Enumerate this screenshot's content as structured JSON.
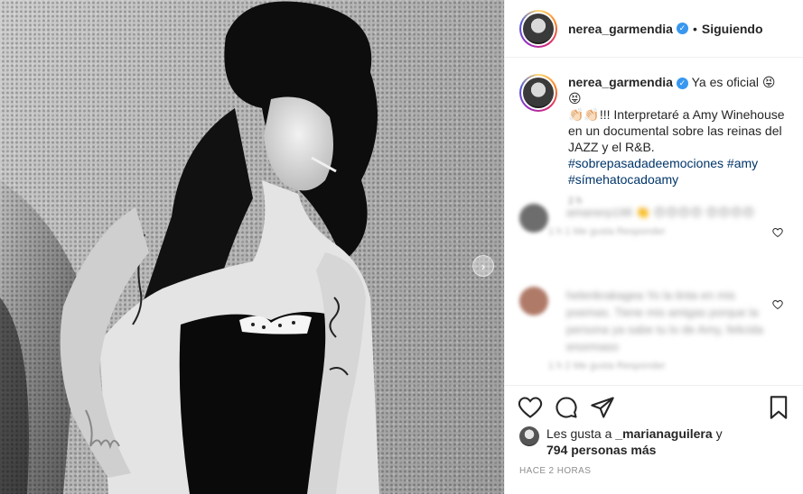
{
  "header": {
    "username": "nerea_garmendia",
    "separator": "•",
    "follow_label": "Siguiendo"
  },
  "caption": {
    "username": "nerea_garmendia",
    "line1": "Ya es oficial 😝😝",
    "line2": "👏🏻👏🏻!!! Interpretaré a Amy Winehouse",
    "line3": "en un documental sobre las reinas del",
    "line4": "JAZZ y el R&B.",
    "hashtags1": "#sobrepasadadeemociones #amy",
    "hashtags2": "#símehatocadoamy",
    "time": "2 h"
  },
  "comments": [
    {
      "text": "amanerp198 👏 😍😍😍😍 😍😍😍😍",
      "meta": "1 h   1 Me gusta   Responder"
    },
    {
      "text": "helenkrakagea Yo la tinta en mis poemas. Tiene mis amigas porque la persona ya sabe tu lo de Amy, felicida enormaso",
      "meta": "1 h   2 Me gusta   Responder"
    }
  ],
  "likes": {
    "prefix": "Les gusta a",
    "user": "_marianaguilera",
    "conj": "y",
    "others": "794 personas más"
  },
  "timestamp": "HACE 2 HORAS",
  "icons": {
    "verified": "verified-badge-icon",
    "like": "heart-icon",
    "comment": "comment-bubble-icon",
    "share": "paper-plane-icon",
    "save": "bookmark-icon",
    "carousel": "chevron-right-icon"
  },
  "colors": {
    "text": "#262626",
    "hashtag": "#003569",
    "verified": "#3897f0",
    "muted": "#8e8e8e"
  }
}
